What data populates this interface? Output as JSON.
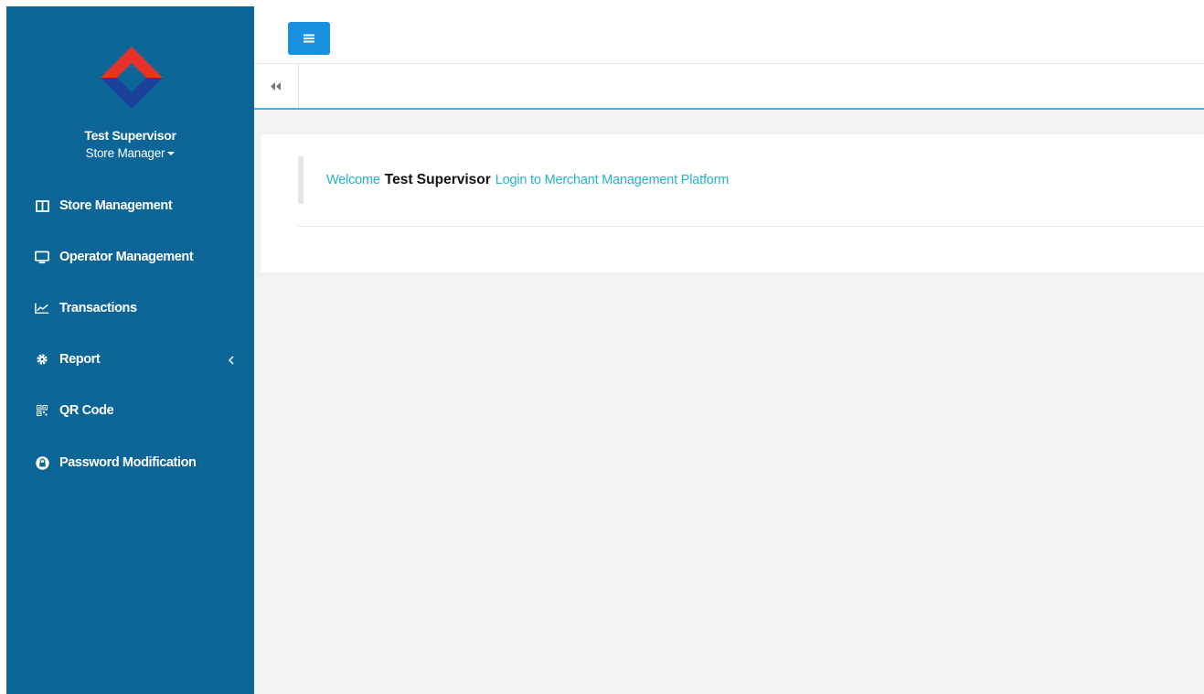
{
  "sidebar": {
    "user_name": "Test Supervisor",
    "user_role": "Store Manager",
    "items": [
      {
        "label": "Store Management",
        "icon": "columns-icon"
      },
      {
        "label": "Operator Management",
        "icon": "monitor-icon"
      },
      {
        "label": "Transactions",
        "icon": "line-chart-icon"
      },
      {
        "label": "Report",
        "icon": "gear-icon",
        "has_submenu": true
      },
      {
        "label": "QR Code",
        "icon": "qrcode-icon"
      },
      {
        "label": "Password Modification",
        "icon": "lock-icon"
      }
    ]
  },
  "welcome": {
    "prefix": "Welcome",
    "user_name": "Test Supervisor",
    "suffix": "Login to Merchant Management Platform"
  },
  "colors": {
    "sidebar_bg": "#0b6597",
    "accent": "#1990e0",
    "welcome_text": "#22b3c7",
    "logo_red": "#e6322b",
    "logo_blue": "#1c3f9a"
  }
}
